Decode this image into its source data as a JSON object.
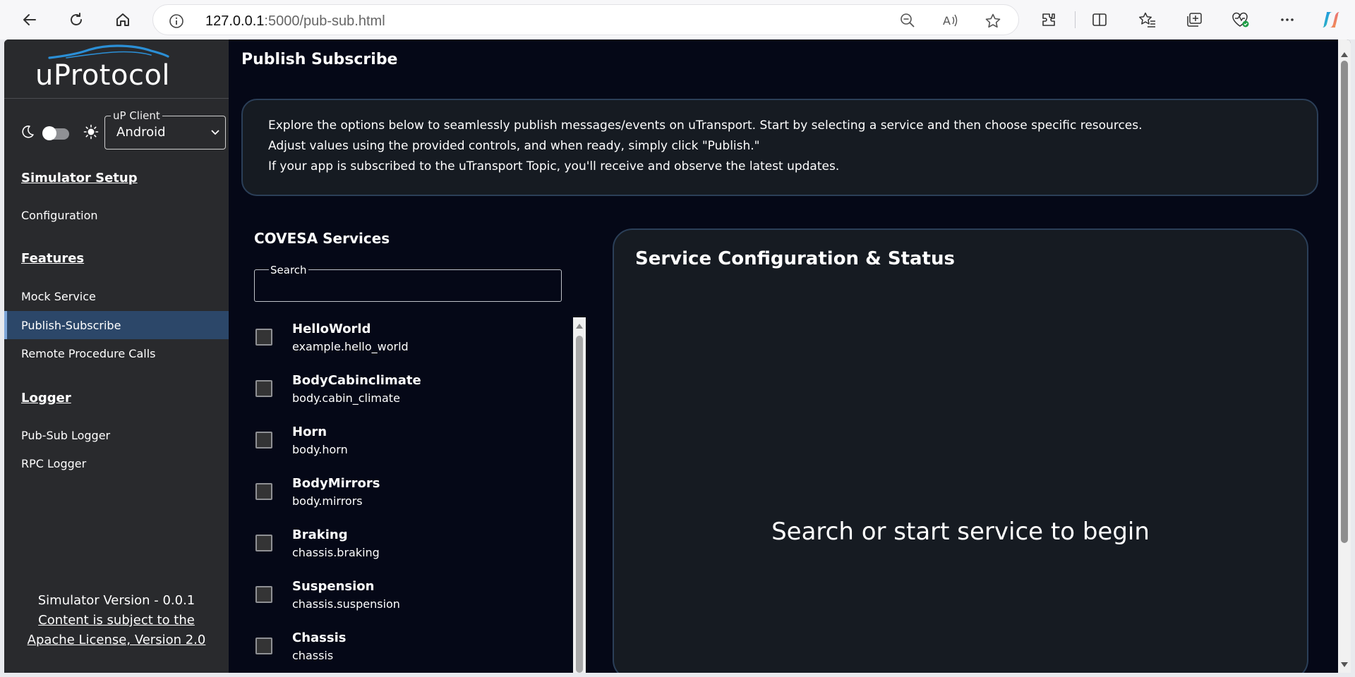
{
  "browser": {
    "url_host": "127.0.0.1",
    "url_rest": ":5000/pub-sub.html",
    "icons": [
      "back-icon",
      "refresh-icon",
      "home-icon",
      "info-icon",
      "zoom-out-icon",
      "read-aloud-icon",
      "favorite-star-icon",
      "extensions-icon",
      "split-screen-icon",
      "favorites-icon",
      "collections-icon",
      "browser-essentials-icon",
      "more-icon",
      "copilot-icon"
    ]
  },
  "sidebar": {
    "logo": "uProtocol",
    "client_label": "uP Client",
    "client_value": "Android",
    "sections": [
      {
        "heading": "Simulator Setup",
        "items": [
          "Configuration"
        ]
      },
      {
        "heading": "Features",
        "items": [
          "Mock Service",
          "Publish-Subscribe",
          "Remote Procedure Calls"
        ]
      },
      {
        "heading": "Logger",
        "items": [
          "Pub-Sub Logger",
          "RPC Logger"
        ]
      }
    ],
    "active_item": "Publish-Subscribe",
    "footer": {
      "version": "Simulator Version - 0.0.1",
      "license": "Content is subject to the Apache License, Version 2.0"
    }
  },
  "main": {
    "title": "Publish Subscribe",
    "intro": [
      "Explore the options below to seamlessly publish messages/events on uTransport. Start by selecting a service and then choose specific resources.",
      "Adjust values using the provided controls, and when ready, simply click \"Publish.\"",
      "If your app is subscribed to the uTransport Topic, you'll receive and observe the latest updates."
    ],
    "services_title": "COVESA Services",
    "search_label": "Search",
    "search_value": "",
    "services": [
      {
        "name": "HelloWorld",
        "id": "example.hello_world",
        "checked": false
      },
      {
        "name": "BodyCabinclimate",
        "id": "body.cabin_climate",
        "checked": false
      },
      {
        "name": "Horn",
        "id": "body.horn",
        "checked": false
      },
      {
        "name": "BodyMirrors",
        "id": "body.mirrors",
        "checked": false
      },
      {
        "name": "Braking",
        "id": "chassis.braking",
        "checked": false
      },
      {
        "name": "Suspension",
        "id": "chassis.suspension",
        "checked": false
      },
      {
        "name": "Chassis",
        "id": "chassis",
        "checked": false
      }
    ],
    "config_title": "Service Configuration & Status",
    "config_empty": "Search or start service to begin"
  }
}
